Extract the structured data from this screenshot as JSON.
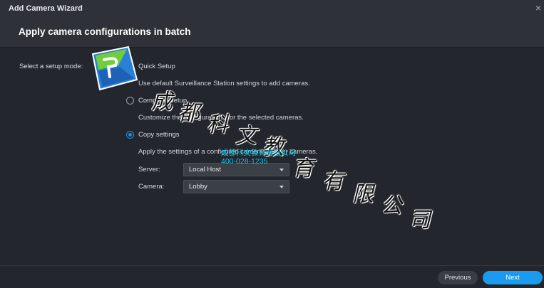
{
  "window": {
    "title": "Add Camera Wizard",
    "close_glyph": "×"
  },
  "header": {
    "heading": "Apply camera configurations in batch"
  },
  "setup": {
    "mode_label": "Select a setup mode:",
    "options": [
      {
        "label": "Quick Setup",
        "description": "Use default Surveillance Station settings to add cameras.",
        "selected": false
      },
      {
        "label": "Complete Setup",
        "description": "Customize the configurations for the selected cameras.",
        "selected": false
      },
      {
        "label": "Copy settings",
        "description": "Apply the settings of a configured camera to other cameras.",
        "selected": true
      }
    ],
    "server": {
      "label": "Server:",
      "value": "Local Host"
    },
    "camera": {
      "label": "Camera:",
      "value": "Lobby"
    }
  },
  "footer": {
    "previous_label": "Previous",
    "next_label": "Next"
  },
  "watermark": {
    "chars": [
      "成",
      "都",
      "科",
      "文",
      "教",
      "育",
      "有",
      "限",
      "公",
      "司"
    ],
    "cyan_line_1": "成都科文教育有限公司",
    "cyan_line_2": "400-028-1235"
  },
  "colors": {
    "accent": "#1a9bf0",
    "background": "#23262c",
    "header": "#2e3137",
    "watermark_cyan": "#19c6e6"
  }
}
